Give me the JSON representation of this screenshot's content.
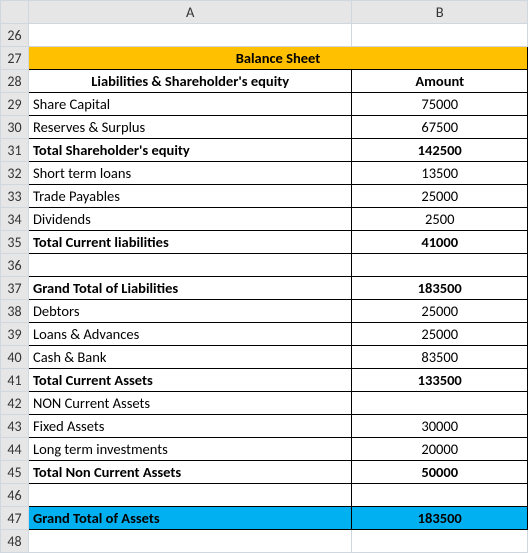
{
  "columns": {
    "A": "A",
    "B": "B"
  },
  "rowStart": 26,
  "title": "Balance Sheet",
  "header": {
    "colA": "Liabilities & Shareholder's equity",
    "colB": "Amount"
  },
  "rows": [
    {
      "r": 29,
      "a": "Share Capital",
      "b": "75000",
      "bold": false
    },
    {
      "r": 30,
      "a": "Reserves & Surplus",
      "b": "67500",
      "bold": false
    },
    {
      "r": 31,
      "a": "Total Shareholder's equity",
      "b": "142500",
      "bold": true
    },
    {
      "r": 32,
      "a": "Short term loans",
      "b": "13500",
      "bold": false
    },
    {
      "r": 33,
      "a": "Trade Payables",
      "b": "25000",
      "bold": false
    },
    {
      "r": 34,
      "a": "Dividends",
      "b": "2500",
      "bold": false
    },
    {
      "r": 35,
      "a": "Total Current liabilities",
      "b": "41000",
      "bold": true
    },
    {
      "r": 36,
      "a": "",
      "b": "",
      "bold": false
    },
    {
      "r": 37,
      "a": "Grand Total of Liabilities",
      "b": "183500",
      "bold": true
    },
    {
      "r": 38,
      "a": "Debtors",
      "b": "25000",
      "bold": false
    },
    {
      "r": 39,
      "a": "Loans & Advances",
      "b": "25000",
      "bold": false
    },
    {
      "r": 40,
      "a": "Cash & Bank",
      "b": "83500",
      "bold": false
    },
    {
      "r": 41,
      "a": "Total Current Assets",
      "b": "133500",
      "bold": true
    },
    {
      "r": 42,
      "a": "NON Current Assets",
      "b": "",
      "bold": false
    },
    {
      "r": 43,
      "a": "Fixed Assets",
      "b": "30000",
      "bold": false
    },
    {
      "r": 44,
      "a": "Long term investments",
      "b": "20000",
      "bold": false
    },
    {
      "r": 45,
      "a": "Total Non Current Assets",
      "b": "50000",
      "bold": true
    },
    {
      "r": 46,
      "a": "",
      "b": "",
      "bold": false
    },
    {
      "r": 47,
      "a": "Grand Total of Assets",
      "b": "183500",
      "bold": true,
      "cyan": true
    }
  ],
  "chart_data": {
    "type": "table",
    "title": "Balance Sheet",
    "columns": [
      "Liabilities & Shareholder's equity",
      "Amount"
    ],
    "rows": [
      [
        "Share Capital",
        75000
      ],
      [
        "Reserves & Surplus",
        67500
      ],
      [
        "Total Shareholder's equity",
        142500
      ],
      [
        "Short term loans",
        13500
      ],
      [
        "Trade Payables",
        25000
      ],
      [
        "Dividends",
        2500
      ],
      [
        "Total Current liabilities",
        41000
      ],
      [
        "Grand Total of Liabilities",
        183500
      ],
      [
        "Debtors",
        25000
      ],
      [
        "Loans & Advances",
        25000
      ],
      [
        "Cash & Bank",
        83500
      ],
      [
        "Total Current Assets",
        133500
      ],
      [
        "NON Current Assets",
        null
      ],
      [
        "Fixed Assets",
        30000
      ],
      [
        "Long term investments",
        20000
      ],
      [
        "Total Non Current Assets",
        50000
      ],
      [
        "Grand Total of Assets",
        183500
      ]
    ]
  }
}
